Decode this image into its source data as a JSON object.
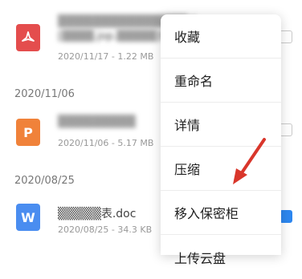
{
  "files": [
    {
      "title": "▒▒▒▒▒▒▒▒▒▒▒▒▒▒▒冶",
      "subtitle": "[▒▒▒▒.jop.▒▒▒▒▒]f",
      "date": "2020/11/17",
      "size": "1.22 MB",
      "icon": "pdf-icon",
      "icon_color": "#e44d4d",
      "icon_label": ""
    },
    {
      "title": "▒▒▒▒▒▒▒▒▒",
      "subtitle": "",
      "date": "2020/11/06",
      "size": "5.17 MB",
      "icon": "ppt-icon",
      "icon_color": "#f0823a",
      "icon_label": "P"
    },
    {
      "title": "▒▒▒▒▒表.doc",
      "subtitle": "",
      "date": "2020/08/25",
      "size": "34.3 KB",
      "icon": "word-icon",
      "icon_color": "#4a8df0",
      "icon_label": "W"
    }
  ],
  "sections": [
    {
      "date": "2020/11/06"
    },
    {
      "date": "2020/08/25"
    }
  ],
  "context_menu": {
    "items": [
      "收藏",
      "重命名",
      "详情",
      "压缩",
      "移入保密柜",
      "上传云盘"
    ]
  },
  "annotation": {
    "arrow_color": "#d9362b"
  }
}
